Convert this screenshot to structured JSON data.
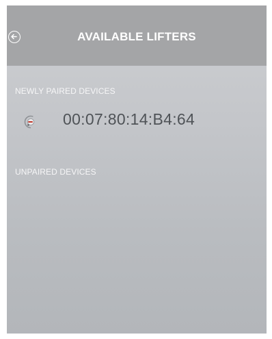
{
  "header": {
    "title": "AVAILABLE LIFTERS",
    "back_icon": "back-arrow-circle-icon"
  },
  "sections": {
    "newly_paired": {
      "label": "NEWLY PAIRED DEVICES",
      "devices": [
        {
          "address": "00:07:80:14:B4:64",
          "icon": "lifter-device-icon"
        }
      ]
    },
    "unpaired": {
      "label": "UNPAIRED DEVICES",
      "devices": []
    }
  },
  "colors": {
    "header_bg": "#a4a5a7",
    "screen_bg": "#c4c6ca",
    "label_text": "#f6f6f7",
    "device_text": "#4f5357"
  }
}
